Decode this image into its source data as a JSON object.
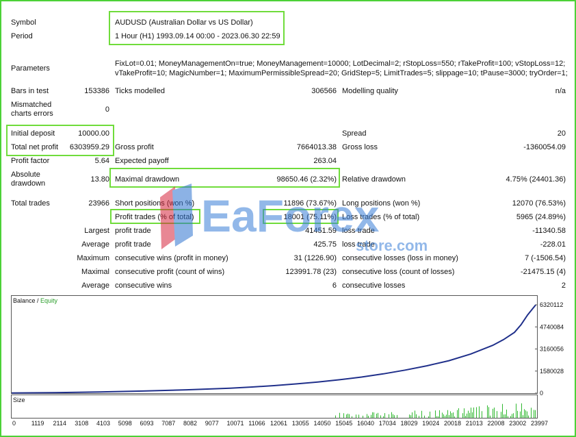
{
  "report": {
    "symbol": {
      "label": "Symbol",
      "value": "AUDUSD (Australian Dollar vs US Dollar)"
    },
    "period": {
      "label": "Period",
      "value": "1 Hour (H1) 1993.09.14 00:00 - 2023.06.30 22:59"
    },
    "parameters": {
      "label": "Parameters",
      "line1": "FixLot=0.01; MoneyManagementOn=true; MoneyManagement=10000; LotDecimal=2; rStopLoss=550; rTakeProfit=100; vStopLoss=12;",
      "line2": "vTakeProfit=10; MagicNumber=1; MaximumPermissibleSpread=20; GridStep=5; LimitTrades=5; slippage=10; tPause=3000; tryOrder=1;"
    },
    "bars_in_test": {
      "label": "Bars in test",
      "value": "153386"
    },
    "ticks_modelled": {
      "label": "Ticks modelled",
      "value": "306566"
    },
    "modelling_quality": {
      "label": "Modelling quality",
      "value": "n/a"
    },
    "mismatched": {
      "label1": "Mismatched",
      "label2": "charts errors",
      "value": "0"
    },
    "initial_deposit": {
      "label": "Initial deposit",
      "value": "10000.00"
    },
    "spread": {
      "label": "Spread",
      "value": "20"
    },
    "total_net_profit": {
      "label": "Total net profit",
      "value": "6303959.29"
    },
    "gross_profit": {
      "label": "Gross profit",
      "value": "7664013.38"
    },
    "gross_loss": {
      "label": "Gross loss",
      "value": "-1360054.09"
    },
    "profit_factor": {
      "label": "Profit factor",
      "value": "5.64"
    },
    "expected_payoff": {
      "label": "Expected payoff",
      "value": "263.04"
    },
    "absolute_drawdown": {
      "label1": "Absolute",
      "label2": "drawdown",
      "value": "13.80"
    },
    "maximal_drawdown": {
      "label": "Maximal drawdown",
      "value": "98650.46 (2.32%)"
    },
    "relative_drawdown": {
      "label": "Relative drawdown",
      "value": "4.75% (24401.36)"
    },
    "total_trades": {
      "label": "Total trades",
      "value": "23966"
    },
    "short_positions": {
      "label": "Short positions (won %)",
      "value": "11896 (73.67%)"
    },
    "long_positions": {
      "label": "Long positions (won %)",
      "value": "12070 (76.53%)"
    },
    "profit_trades": {
      "label": "Profit trades (% of total)",
      "value": "18001 (75.11%)"
    },
    "loss_trades": {
      "label": "Loss trades (% of total)",
      "value": "5965 (24.89%)"
    },
    "largest": {
      "label": "Largest",
      "profit_label": "profit trade",
      "profit_value": "41451.59",
      "loss_label": "loss trade",
      "loss_value": "-11340.58"
    },
    "average": {
      "label": "Average",
      "profit_label": "profit trade",
      "profit_value": "425.75",
      "loss_label": "loss trade",
      "loss_value": "-228.01"
    },
    "maximum": {
      "label": "Maximum",
      "wins_label": "consecutive wins (profit in money)",
      "wins_value": "31 (1226.90)",
      "losses_label": "consecutive losses (loss in money)",
      "losses_value": "7 (-1506.54)"
    },
    "maximal": {
      "label": "Maximal",
      "wins_label": "consecutive profit (count of wins)",
      "wins_value": "123991.78 (23)",
      "losses_label": "consecutive loss (count of losses)",
      "losses_value": "-21475.15 (4)"
    },
    "average_consec": {
      "label": "Average",
      "wins_label": "consecutive wins",
      "wins_value": "6",
      "losses_label": "consecutive losses",
      "losses_value": "2"
    }
  },
  "watermark": {
    "main": "EaForex",
    "sub": "store.com"
  },
  "colors": {
    "highlight": "#6fdc3a",
    "balance": "#1f2f8a",
    "equity": "#2a9d2a",
    "volume": "#2fb82f",
    "watermark": "#3a7fd8"
  },
  "chart_data": {
    "type": "line",
    "legend": {
      "balance": "Balance",
      "separator": " / ",
      "equity": "Equity"
    },
    "size_label": "Size",
    "x_ticks": [
      "0",
      "1119",
      "2114",
      "3108",
      "4103",
      "5098",
      "6093",
      "7087",
      "8082",
      "9077",
      "10071",
      "11066",
      "12061",
      "13055",
      "14050",
      "15045",
      "16040",
      "17034",
      "18029",
      "19024",
      "20018",
      "21013",
      "22008",
      "23002",
      "23997"
    ],
    "y_ticks": [
      "6320112",
      "4740084",
      "3160056",
      "1580028",
      "0"
    ],
    "ylim": [
      0,
      6320112
    ],
    "xlim": [
      0,
      23966
    ],
    "series": [
      {
        "name": "Balance",
        "x": [
          0,
          2000,
          4000,
          6000,
          8000,
          10000,
          11000,
          12000,
          13000,
          14000,
          15000,
          16000,
          17000,
          18000,
          19000,
          20000,
          21000,
          22000,
          22500,
          23000,
          23300,
          23600,
          23966
        ],
        "y": [
          10000,
          40000,
          90000,
          150000,
          240000,
          360000,
          440000,
          540000,
          660000,
          800000,
          960000,
          1150000,
          1380000,
          1650000,
          1960000,
          2320000,
          2800000,
          3420000,
          3830000,
          4350000,
          4900000,
          5600000,
          6303959
        ]
      }
    ]
  }
}
